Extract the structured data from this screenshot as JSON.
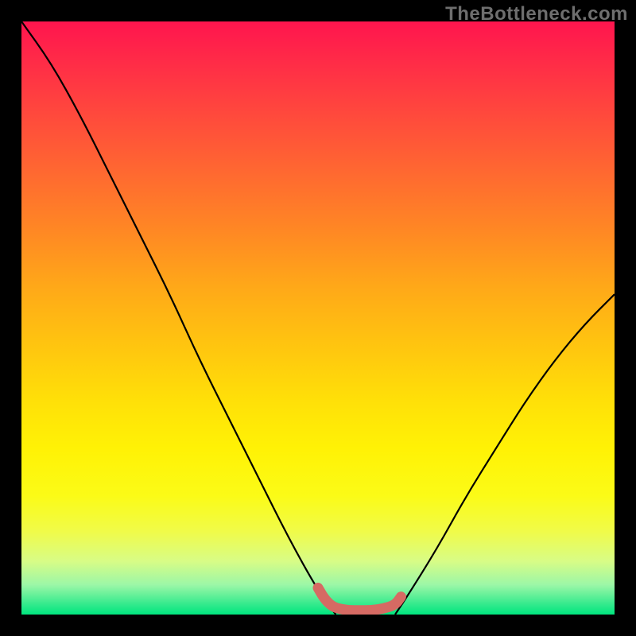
{
  "watermark": "TheBottleneck.com",
  "chart_data": {
    "type": "line",
    "title": "",
    "xlabel": "",
    "ylabel": "",
    "xlim": [
      0,
      100
    ],
    "ylim": [
      0,
      100
    ],
    "background_gradient": {
      "direction": "vertical",
      "stops": [
        {
          "pos": 0,
          "color": "#ff154e"
        },
        {
          "pos": 50,
          "color": "#ffc60f"
        },
        {
          "pos": 80,
          "color": "#fbfb17"
        },
        {
          "pos": 100,
          "color": "#00e57e"
        }
      ]
    },
    "series": [
      {
        "name": "left-curve",
        "color": "#000000",
        "x": [
          0,
          5,
          10,
          15,
          20,
          25,
          30,
          35,
          40,
          45,
          50,
          53
        ],
        "y": [
          100,
          93,
          84,
          74,
          64,
          54,
          43,
          33,
          23,
          13,
          4,
          0
        ]
      },
      {
        "name": "right-curve",
        "color": "#000000",
        "x": [
          63,
          65,
          70,
          75,
          80,
          85,
          90,
          95,
          100
        ],
        "y": [
          0,
          3,
          11,
          20,
          28,
          36,
          43,
          49,
          54
        ]
      },
      {
        "name": "bottom-marker-band",
        "color": "#d66a63",
        "x": [
          50,
          51,
          52,
          53,
          55,
          57,
          59,
          61,
          63,
          64
        ],
        "y": [
          4.5,
          2.8,
          1.7,
          1.1,
          0.7,
          0.7,
          0.7,
          1.0,
          1.6,
          3.0
        ]
      }
    ]
  }
}
